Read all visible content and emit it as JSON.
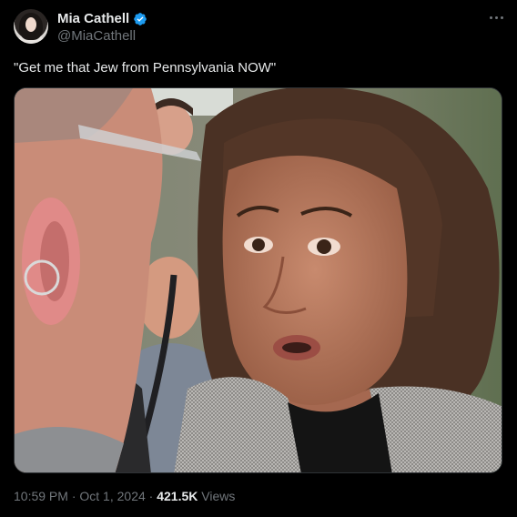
{
  "author": {
    "display_name": "Mia Cathell",
    "handle": "@MiaCathell",
    "verified_color": "#1d9bf0"
  },
  "tweet": {
    "text": "\"Get me that Jew from Pennsylvania NOW\"",
    "time": "10:59 PM",
    "separator": "·",
    "date": "Oct 1, 2024",
    "views_count": "421.5K",
    "views_label": "Views"
  },
  "icons": {
    "verified": "verified-badge-icon",
    "more": "more-options-icon"
  },
  "colors": {
    "background": "#000000",
    "text": "#e7e9ea",
    "secondary_text": "#71767b"
  }
}
